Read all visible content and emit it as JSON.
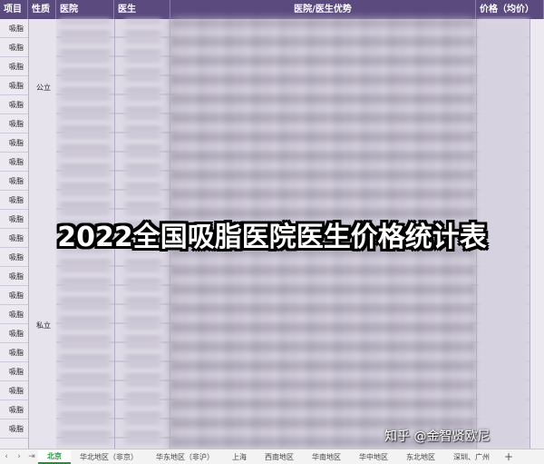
{
  "headers": [
    "项目",
    "性质",
    "医院",
    "医生",
    "医院/医生优势",
    "价格（均价）"
  ],
  "project_label": "吸脂",
  "row_count": 22,
  "nature_public": "公立",
  "nature_private": "私立",
  "overlay_title": "2022全国吸脂医院医生价格统计表",
  "watermark": "知乎 @金智贤欧尼",
  "tabs": {
    "nav_prev": "‹",
    "nav_next": "›",
    "nav_last": "⇥",
    "items": [
      "北京",
      "华北地区（非京）",
      "华东地区（非沪）",
      "上海",
      "西南地区",
      "华南地区",
      "华中地区",
      "东北地区",
      "深圳、广州"
    ],
    "active_index": 0,
    "add": "+"
  },
  "colors": {
    "header_bg": "#5a4a7e",
    "active_tab": "#1f8f3a"
  }
}
